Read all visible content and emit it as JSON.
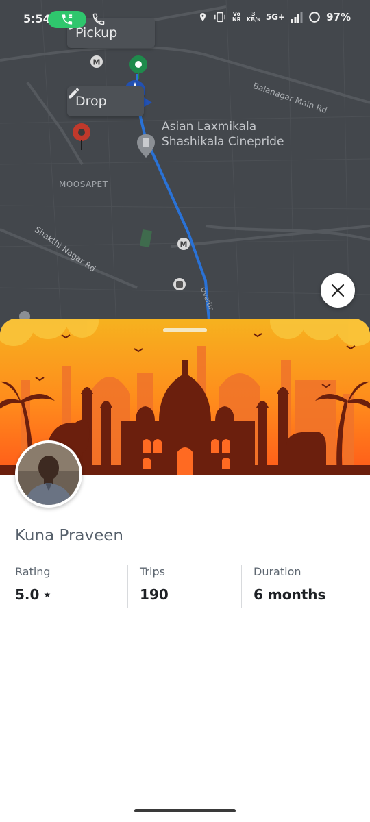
{
  "status_bar": {
    "time": "5:54",
    "network_top": "Vo",
    "network_bottom": "NR",
    "speed_top": "3",
    "speed_bottom": "KB/s",
    "signal": "5G+",
    "battery": "97%"
  },
  "map": {
    "pickup_label": "Pickup",
    "drop_label": "Drop",
    "places": {
      "cinema_line1": "Asian Laxmikala",
      "cinema_line2": "Shashikala Cinepride",
      "area": "MOOSAPET",
      "road1": "Balanagar Main Rd",
      "road2": "Shakthi Nagar Rd",
      "road3": "OverBr"
    },
    "metro_marker": "M",
    "colors": {
      "route": "#2a72d6",
      "pickup_pin": "#1f8a4c",
      "drop_pin": "#c0392b"
    }
  },
  "close_button": {
    "icon": "close-icon"
  },
  "driver": {
    "name": "Kuna Praveen",
    "stats": [
      {
        "label": "Rating",
        "value": "5.0",
        "suffix": "★"
      },
      {
        "label": "Trips",
        "value": "190"
      },
      {
        "label": "Duration",
        "value": "6 months"
      }
    ]
  },
  "banner": {
    "colors": {
      "sky_top": "#f7a21b",
      "sky_bottom": "#ff7a1a",
      "silhouette": "#6b1f0d"
    }
  }
}
